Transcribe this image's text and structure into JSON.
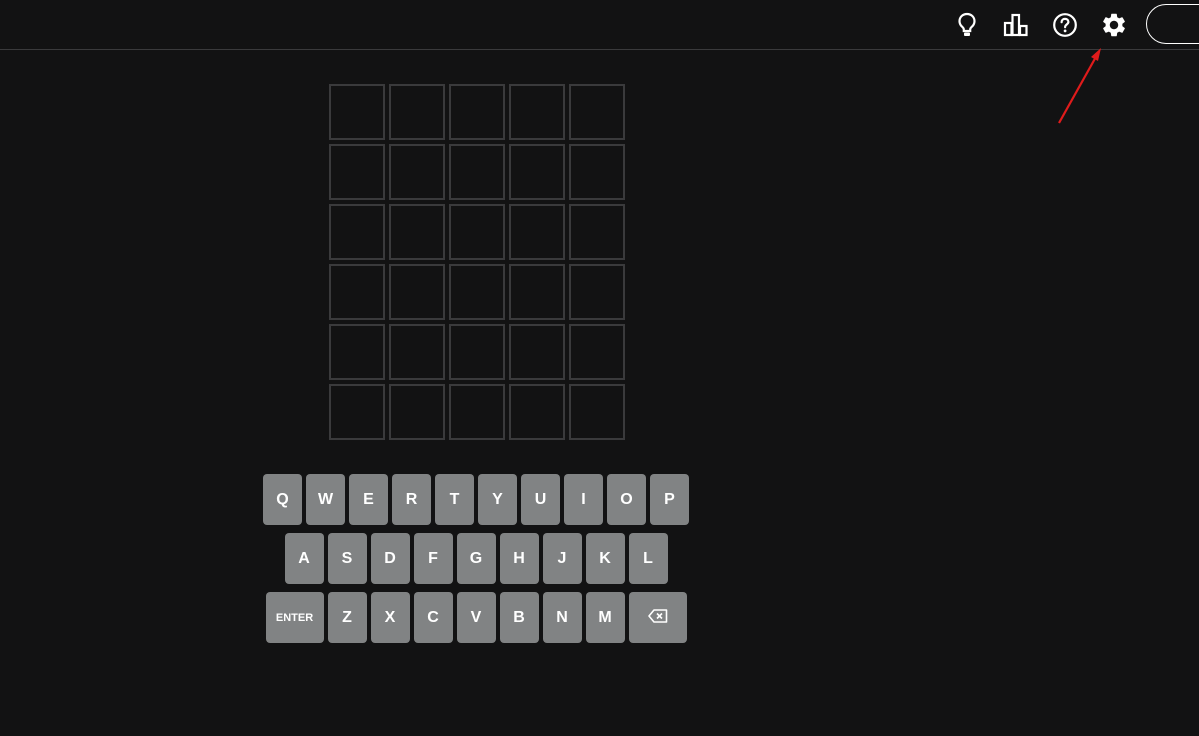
{
  "header": {
    "icons": {
      "hint": "lightbulb-icon",
      "stats": "bar-chart-icon",
      "help": "question-circle-icon",
      "settings": "gear-icon"
    },
    "icon_color": "#ffffff"
  },
  "board": {
    "rows": [
      [
        "",
        "",
        "",
        "",
        ""
      ],
      [
        "",
        "",
        "",
        "",
        ""
      ],
      [
        "",
        "",
        "",
        "",
        ""
      ],
      [
        "",
        "",
        "",
        "",
        ""
      ],
      [
        "",
        "",
        "",
        "",
        ""
      ],
      [
        "",
        "",
        "",
        "",
        ""
      ]
    ],
    "tile_border_color": "#3a3a3c"
  },
  "keyboard": {
    "row1": [
      "Q",
      "W",
      "E",
      "R",
      "T",
      "Y",
      "U",
      "I",
      "O",
      "P"
    ],
    "row2": [
      "A",
      "S",
      "D",
      "F",
      "G",
      "H",
      "J",
      "K",
      "L"
    ],
    "row3": [
      "ENTER",
      "Z",
      "X",
      "C",
      "V",
      "B",
      "N",
      "M"
    ],
    "backspace_icon": "backspace-icon",
    "key_color": "#818384"
  },
  "annotation": {
    "arrow_color": "#e01b1b"
  },
  "colors": {
    "background": "#121213",
    "divider": "#3a3a3c"
  }
}
